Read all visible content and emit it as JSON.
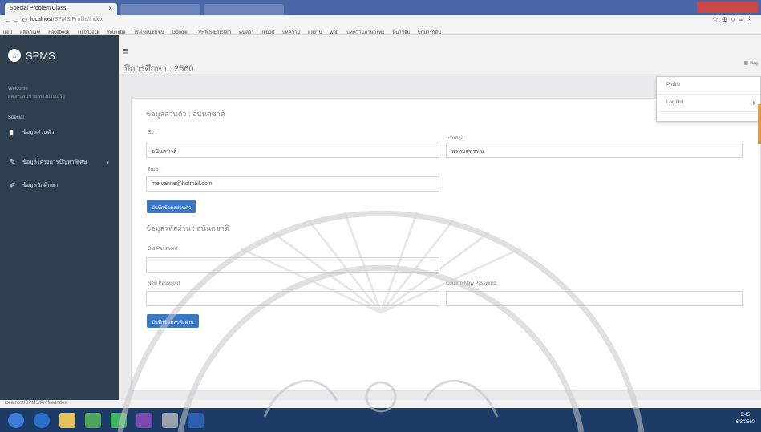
{
  "browser": {
    "tab_title": "Special Problem Class",
    "tab_close": "×",
    "url_host": "localhost",
    "url_path": "/SPMS/Profile/Index",
    "bookmarks": [
      "แอป",
      "ผลิตภัณฑ์",
      "Facebook",
      "TutorDeck",
      "YouTube",
      "โรงเรียนชุมชน",
      "Google",
      "- VRMS Emblem",
      "ค้นคว้า",
      "report",
      "บทความ",
      "ผลงาน",
      "web",
      "บทความภาษาไทย",
      "หน้าวิจัย",
      "บุ๊กมาร์กอื่น"
    ]
  },
  "sidebar": {
    "brand": "SPMS",
    "welcome_label": "Welcome",
    "welcome_user": "ผศ.ดร.สมชาย ทองประเสริฐ",
    "section_label": "Special",
    "items": [
      {
        "label": "ข้อมูลส่วนตัว",
        "icon": "bookmark-icon"
      },
      {
        "label": "ข้อมูลโครงการปัญหาพิเศษ",
        "icon": "pencil-icon"
      },
      {
        "label": "ข้อมูลนักศึกษา",
        "icon": "edit-icon"
      }
    ]
  },
  "header": {
    "burger": "≡",
    "title": "ปีการศึกษา : 2560",
    "menu_label": "เมนู"
  },
  "dropdown": {
    "items": [
      "Profile",
      "Log Out"
    ]
  },
  "form": {
    "personal_title": "ข้อมูลส่วนตัว : อนันตชาติ",
    "name_label": "ชื่อ :",
    "name_value": "อนันตชาติ",
    "lastname_label": "นามสกุล :",
    "lastname_value": "พรหมสุพรรณ",
    "email_label": "อีเมล :",
    "email_value": "me.vanne@hotmail.com",
    "save_personal": "บันทึกข้อมูลส่วนตัว",
    "password_title": "ข้อมูลรหัสผ่าน : อนันตชาติ",
    "old_password_label": "Old Password",
    "new_password_label": "New Password",
    "confirm_password_label": "Confirm New Password",
    "save_password": "บันทึกข้อมูลรหัสผ่าน"
  },
  "taskbar": {
    "status_text": "localhost/SPMS/Profile/Index",
    "time": "9:45",
    "date": "6/3/2560"
  },
  "colors": {
    "sidebar": "#2f3f4e",
    "primary_button": "#3a78c4",
    "taskbar": "#1c3b66",
    "tab_strip": "#4a68a8"
  }
}
